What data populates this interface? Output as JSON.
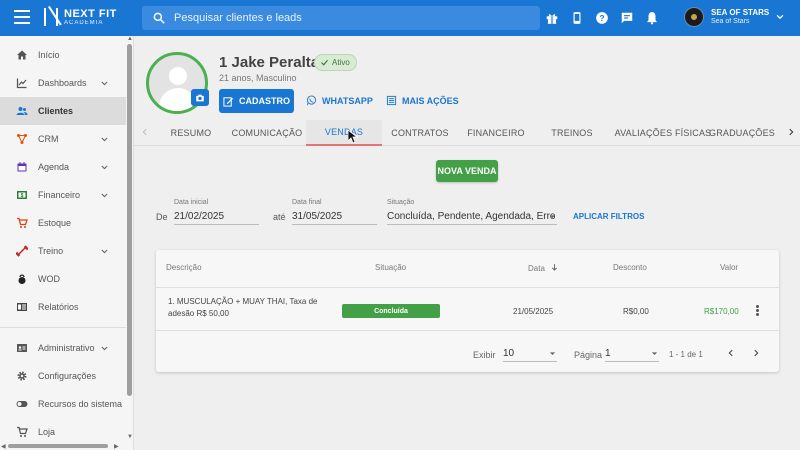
{
  "app": {
    "logo_name": "NEXT FIT",
    "logo_sub": "ACADEMIA",
    "search_placeholder": "Pesquisar clientes e leads",
    "user_name": "SEA OF STARS",
    "user_sub": "Sea of Stars",
    "brand_color": "#1976d2",
    "success_color": "#43a047"
  },
  "top_icons": [
    "gift-icon",
    "mobile-icon",
    "help-icon",
    "chat-icon",
    "bell-icon"
  ],
  "sidebar": {
    "items": [
      {
        "label": "Início",
        "icon": "home-icon"
      },
      {
        "label": "Dashboards",
        "icon": "chart-icon"
      },
      {
        "label": "Clientes",
        "icon": "people-icon"
      },
      {
        "label": "CRM",
        "icon": "crm-icon"
      },
      {
        "label": "Agenda",
        "icon": "calendar-icon"
      },
      {
        "label": "Financeiro",
        "icon": "money-icon"
      },
      {
        "label": "Estoque",
        "icon": "cart-icon"
      },
      {
        "label": "Treino",
        "icon": "dumbbell-icon"
      },
      {
        "label": "WOD",
        "icon": "kettlebell-icon"
      },
      {
        "label": "Relatórios",
        "icon": "report-icon"
      },
      {
        "label": "Administrativo",
        "icon": "id-card-icon"
      },
      {
        "label": "Configurações",
        "icon": "gear-icon"
      },
      {
        "label": "Recursos do sistema",
        "icon": "toggle-icon"
      },
      {
        "label": "Loja",
        "icon": "cart-icon"
      }
    ]
  },
  "client": {
    "name": "1 Jake Peralta",
    "status": "Ativo",
    "info": "21 anos, Masculino",
    "btn_cadastro": "CADASTRO",
    "btn_whatsapp": "WHATSAPP",
    "btn_mais": "MAIS AÇÕES"
  },
  "tabs": [
    "RESUMO",
    "COMUNICAÇÃO",
    "VENDAS",
    "CONTRATOS",
    "FINANCEIRO",
    "TREINOS",
    "AVALIAÇÕES FÍSICAS",
    "GRADUAÇÕES"
  ],
  "active_tab": "VENDAS",
  "actions": {
    "nova_venda": "NOVA VENDA"
  },
  "filters": {
    "de": "De",
    "ate": "até",
    "data_inicial_label": "Data inicial",
    "data_inicial": "21/02/2025",
    "data_final_label": "Data final",
    "data_final": "31/05/2025",
    "situacao_label": "Situação",
    "situacao": "Concluída, Pendente, Agendada, Erro",
    "apply": "APLICAR FILTROS"
  },
  "table": {
    "headers": {
      "descricao": "Descrição",
      "situacao": "Situação",
      "data": "Data",
      "desconto": "Desconto",
      "valor": "Valor"
    },
    "rows": [
      {
        "descricao": "1. MUSCULAÇÃO + MUAY THAI, Taxa de adesão R$ 50,00",
        "situacao": "Concluída",
        "data": "21/05/2025",
        "desconto": "R$0,00",
        "valor": "R$170,00"
      }
    ]
  },
  "pagination": {
    "exibir_label": "Exibir",
    "exibir_value": "10",
    "pagina_label": "Página",
    "pagina_value": "1",
    "range": "1 - 1 de 1"
  }
}
